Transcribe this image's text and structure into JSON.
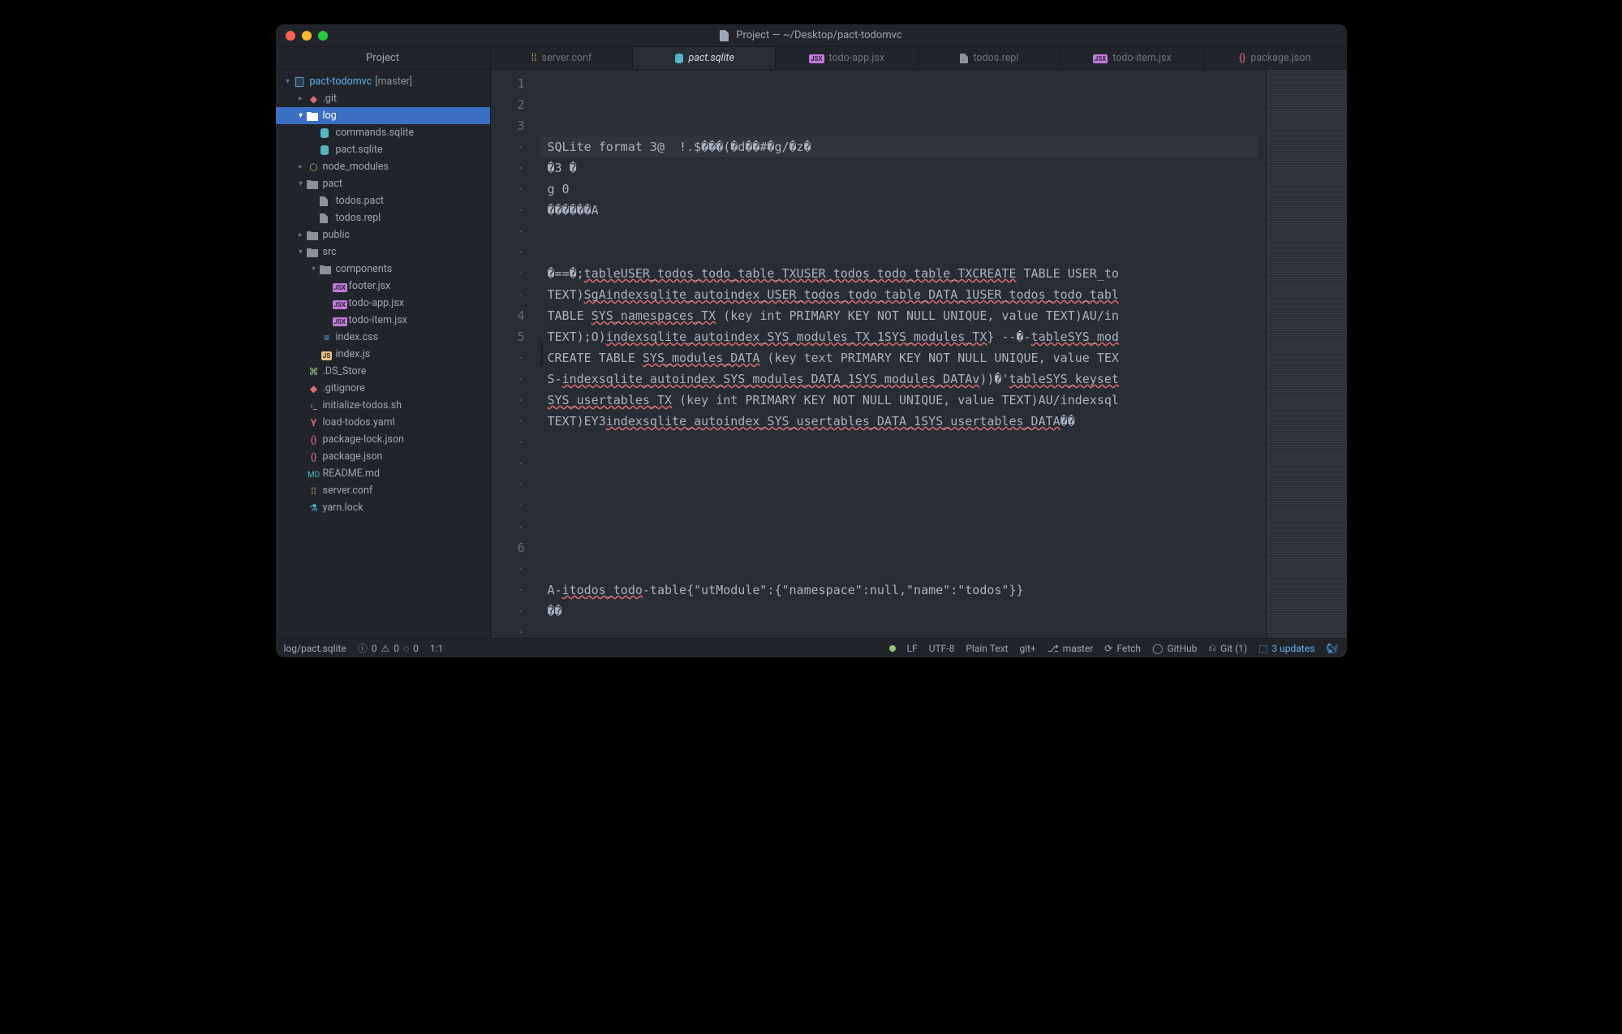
{
  "window": {
    "title": "Project — ~/Desktop/pact-todomvc"
  },
  "sidebar": {
    "title": "Project",
    "project_name": "pact-todomvc",
    "branch_tag": "[master]"
  },
  "tree": [
    {
      "label": ".git",
      "depth": 1,
      "kind": "folder-git",
      "chev": "right"
    },
    {
      "label": "log",
      "depth": 1,
      "kind": "folder",
      "chev": "down",
      "selected": true
    },
    {
      "label": "commands.sqlite",
      "depth": 2,
      "kind": "db",
      "chev": ""
    },
    {
      "label": "pact.sqlite",
      "depth": 2,
      "kind": "db",
      "chev": ""
    },
    {
      "label": "node_modules",
      "depth": 1,
      "kind": "folder-node",
      "chev": "right"
    },
    {
      "label": "pact",
      "depth": 1,
      "kind": "folder",
      "chev": "down"
    },
    {
      "label": "todos.pact",
      "depth": 2,
      "kind": "file",
      "chev": ""
    },
    {
      "label": "todos.repl",
      "depth": 2,
      "kind": "file",
      "chev": ""
    },
    {
      "label": "public",
      "depth": 1,
      "kind": "folder",
      "chev": "right"
    },
    {
      "label": "src",
      "depth": 1,
      "kind": "folder",
      "chev": "down"
    },
    {
      "label": "components",
      "depth": 2,
      "kind": "folder",
      "chev": "down"
    },
    {
      "label": "footer.jsx",
      "depth": 3,
      "kind": "jsx",
      "chev": ""
    },
    {
      "label": "todo-app.jsx",
      "depth": 3,
      "kind": "jsx",
      "chev": ""
    },
    {
      "label": "todo-item.jsx",
      "depth": 3,
      "kind": "jsx",
      "chev": ""
    },
    {
      "label": "index.css",
      "depth": 2,
      "kind": "css",
      "chev": ""
    },
    {
      "label": "index.js",
      "depth": 2,
      "kind": "js",
      "chev": ""
    },
    {
      "label": ".DS_Store",
      "depth": 1,
      "kind": "ds",
      "chev": ""
    },
    {
      "label": ".gitignore",
      "depth": 1,
      "kind": "git",
      "chev": ""
    },
    {
      "label": "initialize-todos.sh",
      "depth": 1,
      "kind": "sh",
      "chev": ""
    },
    {
      "label": "load-todos.yaml",
      "depth": 1,
      "kind": "yaml",
      "chev": ""
    },
    {
      "label": "package-lock.json",
      "depth": 1,
      "kind": "json",
      "chev": ""
    },
    {
      "label": "package.json",
      "depth": 1,
      "kind": "json",
      "chev": ""
    },
    {
      "label": "README.md",
      "depth": 1,
      "kind": "md",
      "chev": ""
    },
    {
      "label": "server.conf",
      "depth": 1,
      "kind": "conf",
      "chev": ""
    },
    {
      "label": "yarn.lock",
      "depth": 1,
      "kind": "yarn",
      "chev": ""
    }
  ],
  "tabs": [
    {
      "label": "server.conf",
      "icon": "conf",
      "active": false
    },
    {
      "label": "pact.sqlite",
      "icon": "db",
      "active": true
    },
    {
      "label": "todo-app.jsx",
      "icon": "jsx",
      "active": false
    },
    {
      "label": "todos.repl",
      "icon": "file",
      "active": false
    },
    {
      "label": "todo-item.jsx",
      "icon": "jsx",
      "active": false
    },
    {
      "label": "package.json",
      "icon": "json",
      "active": false
    }
  ],
  "editor": {
    "gutter": [
      "1",
      "2",
      "3",
      "·",
      "·",
      "·",
      "·",
      "·",
      "·",
      "·",
      "·",
      "4",
      "5",
      "·",
      "·",
      "·",
      "·",
      "·",
      "·",
      "·",
      "·",
      "·",
      "6",
      "·",
      "·",
      "·",
      "·"
    ],
    "lines": [
      "SQLite format 3@  !.$���(�d��#�g/�z�",
      "�3 �",
      "g 0",
      "������A",
      "",
      "",
      "�==�;tableUSER_todos_todo_table_TXUSER_todos_todo_table_TXCREATE TABLE USER_to",
      "TEXT)SgAindexsqlite_autoindex_USER_todos_todo_table_DATA_1USER_todos_todo_tabl",
      "TABLE SYS_namespaces_TX (key int PRIMARY KEY NOT NULL UNIQUE, value TEXT)AU/in",
      "TEXT);O)indexsqlite_autoindex_SYS_modules_TX_1SYS_modules_TX} --�-tableSYS_mod",
      "CREATE TABLE SYS_modules_DATA (key text PRIMARY KEY NOT NULL UNIQUE, value TEX",
      "S-indexsqlite_autoindex_SYS_modules_DATA_1SYS_modules_DATAv))�'tableSYS_keyset",
      "SYS_usertables_TX (key int PRIMARY KEY NOT NULL UNIQUE, value TEXT)AU/indexsql",
      "TEXT)EY3indexsqlite_autoindex_SYS_usertables_DATA_1SYS_usertables_DATA��",
      "",
      "",
      "",
      "",
      "",
      "",
      "",
      "A-itodos_todo-table{\"utModule\":{\"namespace\":null,\"name\":\"todos\"}}",
      "��",
      "",
      "",
      "",
      ""
    ]
  },
  "statusbar": {
    "path": "log/pact.sqlite",
    "err_count": "0",
    "warn_count": "0",
    "info_count": "0",
    "line_col": "1:1",
    "line_ending": "LF",
    "encoding": "UTF-8",
    "grammar": "Plain Text",
    "git_plus": "git+",
    "branch": "master",
    "fetch": "Fetch",
    "github": "GitHub",
    "git_count": "Git (1)",
    "updates": "3 updates"
  }
}
